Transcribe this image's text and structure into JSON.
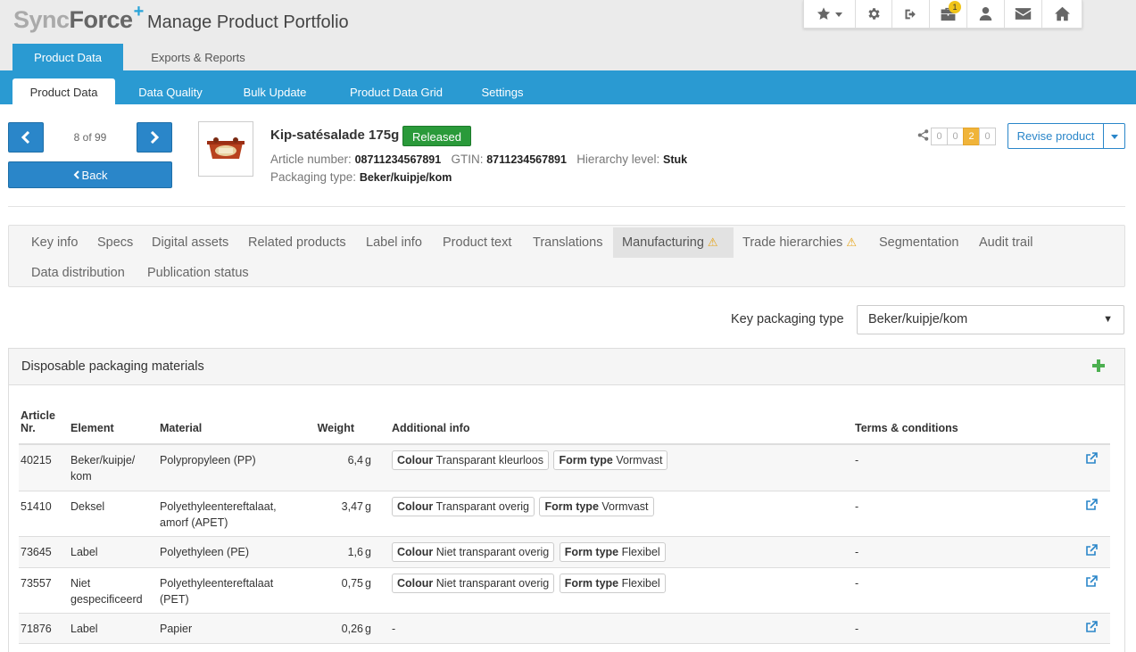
{
  "header": {
    "logo_sync": "Sync",
    "logo_force": "Force",
    "logo_plus": "+",
    "app_title": "Manage Product Portfolio",
    "notification_count": "1"
  },
  "main_tabs": [
    "Product Data",
    "Exports & Reports"
  ],
  "sub_tabs": [
    "Product Data",
    "Data Quality",
    "Bulk Update",
    "Product Data Grid",
    "Settings"
  ],
  "pager": {
    "count": "8 of 99",
    "back_label": "Back"
  },
  "product": {
    "name": "Kip-satésalade 175g",
    "status": "Released",
    "article_label": "Article number:",
    "article_value": "08711234567891",
    "gtin_label": "GTIN:",
    "gtin_value": "8711234567891",
    "hierarchy_label": "Hierarchy level:",
    "hierarchy_value": "Stuk",
    "packaging_label": "Packaging type:",
    "packaging_value": "Beker/kuipje/kom"
  },
  "share_counters": [
    "0",
    "0",
    "2",
    "0"
  ],
  "revise_label": "Revise product",
  "section_tabs": [
    "Key info",
    "Specs",
    "Digital assets",
    "Related products",
    "Label info",
    "Product text",
    "Translations",
    "Manufacturing",
    "Trade hierarchies",
    "Segmentation",
    "Audit trail",
    "Data distribution",
    "Publication status"
  ],
  "key_packaging": {
    "label": "Key packaging type",
    "value": "Beker/kuipje/kom"
  },
  "panel": {
    "title": "Disposable packaging materials",
    "columns": {
      "article_line1": "Article",
      "article_line2": "Nr.",
      "element": "Element",
      "material": "Material",
      "weight": "Weight",
      "additional": "Additional info",
      "terms": "Terms & conditions"
    },
    "rows": [
      {
        "article": "40215",
        "element_a": "Beker/kuipje/",
        "element_b": "kom",
        "material_a": "Polypropyleen (PP)",
        "material_b": "",
        "weight": "6,4",
        "unit": "g",
        "colour_label": "Colour",
        "colour": "Transparant kleurloos",
        "form_label": "Form type",
        "form": "Vormvast",
        "terms": "-"
      },
      {
        "article": "51410",
        "element_a": "Deksel",
        "element_b": "",
        "material_a": "Polyethyleentereftalaat,",
        "material_b": "amorf (APET)",
        "weight": "3,47",
        "unit": "g",
        "colour_label": "Colour",
        "colour": "Transparant overig",
        "form_label": "Form type",
        "form": "Vormvast",
        "terms": "-"
      },
      {
        "article": "73645",
        "element_a": "Label",
        "element_b": "",
        "material_a": "Polyethyleen (PE)",
        "material_b": "",
        "weight": "1,6",
        "unit": "g",
        "colour_label": "Colour",
        "colour": "Niet transparant overig",
        "form_label": "Form type",
        "form": "Flexibel",
        "terms": "-"
      },
      {
        "article": "73557",
        "element_a": "Niet",
        "element_b": "gespecificeerd",
        "material_a": "Polyethyleentereftalaat",
        "material_b": "(PET)",
        "weight": "0,75",
        "unit": "g",
        "colour_label": "Colour",
        "colour": "Niet transparant overig",
        "form_label": "Form type",
        "form": "Flexibel",
        "terms": "-"
      },
      {
        "article": "71876",
        "element_a": "Label",
        "element_b": "",
        "material_a": "Papier",
        "material_b": "",
        "weight": "0,26",
        "unit": "g",
        "additional_text": "-",
        "terms": "-"
      }
    ]
  }
}
